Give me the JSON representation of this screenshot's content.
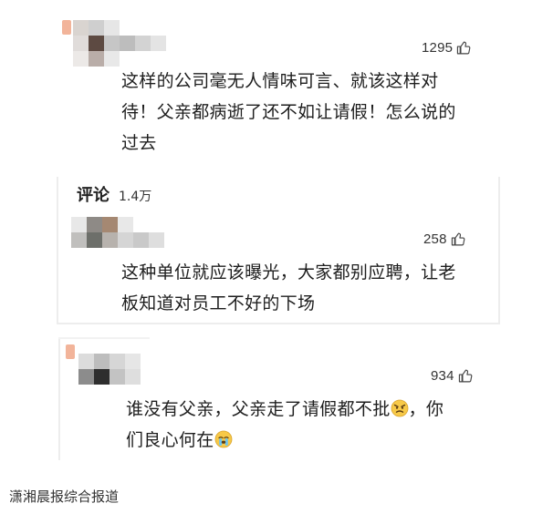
{
  "comments": [
    {
      "likes": "1295",
      "text_lines": [
        "这样的公司毫无人情味可言、就该这样对",
        "待！父亲都病逝了还不如让请假！怎么说的",
        "过去"
      ]
    },
    {
      "likes": "258",
      "text_lines": [
        "这种单位就应该曝光，大家都别应聘，让老",
        "板知道对员工不好的下场"
      ]
    },
    {
      "likes": "934",
      "text_line1_before_emoji": "谁没有父亲，父亲走了请假都不批",
      "text_line1_after_emoji": "，你",
      "text_line2_before_emoji": "们良心何在",
      "emoji_1": "angry-face-icon",
      "emoji_2": "crying-face-icon"
    }
  ],
  "reply_section": {
    "label": "评论",
    "count": "1.4万"
  },
  "source": "潇湘晨报综合报道",
  "colors": {
    "accent_orange": "#f2b49a",
    "text": "#1e1e1e",
    "border": "#ededed"
  }
}
